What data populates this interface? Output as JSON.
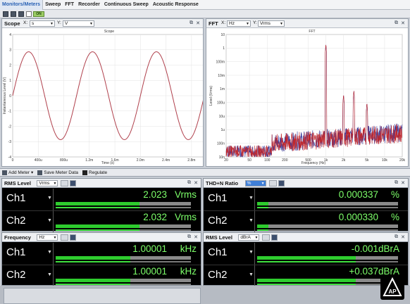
{
  "tabs": [
    "Monitors/Meters",
    "Sweep",
    "FFT",
    "Recorder",
    "Continuous Sweep",
    "Acoustic Response"
  ],
  "toolbar": {
    "on_label": "ON"
  },
  "scope": {
    "title": "Scope",
    "x_label": "X:",
    "x_unit": "s",
    "y_label": "Y:",
    "y_unit": "V",
    "plot_title": "Scope",
    "chart_data": {
      "type": "line",
      "title": "Scope",
      "xlabel": "Time (s)",
      "ylabel": "Instantaneous Level (V)",
      "xlim": [
        0,
        0.003
      ],
      "ylim": [
        -4,
        4
      ],
      "x_ticks": [
        "0",
        "400u",
        "800u",
        "1.2m",
        "1.6m",
        "2.0m",
        "2.4m",
        "2.8m"
      ],
      "y_ticks": [
        "4",
        "3",
        "2",
        "1",
        "0",
        "-1",
        "-2",
        "-3",
        "-4"
      ],
      "series": [
        {
          "frequency_hz": 1000,
          "amplitude_v": 2.87,
          "phase_deg": 0
        }
      ]
    }
  },
  "fft": {
    "title": "FFT",
    "x_label": "X:",
    "x_unit": "Hz",
    "y_label": "Y:",
    "y_unit": "Vrms",
    "plot_title": "FFT",
    "chart_data": {
      "type": "line",
      "title": "FFT",
      "xlabel": "Frequency (Hz)",
      "ylabel": "Level (Vrms)",
      "x_scale": "log",
      "y_scale": "log",
      "xlim": [
        20,
        20000
      ],
      "ylim": [
        1e-08,
        10
      ],
      "x_ticks": [
        "20",
        "50",
        "100",
        "200",
        "500",
        "1k",
        "2k",
        "5k",
        "10k",
        "20k"
      ],
      "y_ticks": [
        "10",
        "1",
        "100m",
        "10m",
        "1m",
        "100u",
        "10u",
        "1u",
        "100n",
        "10n"
      ],
      "series": [
        {
          "name": "Ch1",
          "color": "#3d3f9e"
        },
        {
          "name": "Ch2",
          "color": "#c0272d"
        }
      ],
      "peaks": [
        {
          "x": 1000,
          "y": 2.03
        },
        {
          "x": 2000,
          "y": 0.0004
        },
        {
          "x": 3000,
          "y": 0.0008
        },
        {
          "x": 5000,
          "y": 0.0001
        }
      ]
    }
  },
  "meterbar": {
    "add": "Add Meter",
    "save": "Save Meter Data",
    "regulate": "Regulate"
  },
  "meters": [
    {
      "title": "RMS Level",
      "unit_select": "Vrms",
      "ch": [
        {
          "name": "Ch1",
          "value": "2.023",
          "unit": "Vrms",
          "fill": 0.62
        },
        {
          "name": "Ch2",
          "value": "2.032",
          "unit": "Vrms",
          "fill": 0.62
        }
      ]
    },
    {
      "title": "THD+N Ratio",
      "unit_select": "%",
      "ch": [
        {
          "name": "Ch1",
          "value": "0.000337",
          "unit": "%",
          "fill": 0.08
        },
        {
          "name": "Ch2",
          "value": "0.000330",
          "unit": "%",
          "fill": 0.08
        }
      ]
    },
    {
      "title": "Frequency",
      "unit_select": "Hz",
      "ch": [
        {
          "name": "Ch1",
          "value": "1.00001",
          "unit": "kHz",
          "fill": 0.55
        },
        {
          "name": "Ch2",
          "value": "1.00001",
          "unit": "kHz",
          "fill": 0.55
        }
      ]
    },
    {
      "title": "RMS Level",
      "unit_select": "dBrA",
      "ch": [
        {
          "name": "Ch1",
          "value": "-0.001",
          "unit": "dBrA",
          "fill": 0.7
        },
        {
          "name": "Ch2",
          "value": "+0.037",
          "unit": "dBrA",
          "fill": 0.7
        }
      ]
    }
  ],
  "colors": {
    "accent": "#2a62b5",
    "meter_text": "#7dff6a",
    "meter_fill": "#2ecc2e",
    "scope_trace": "#b0404c"
  },
  "logo_text": "AP"
}
